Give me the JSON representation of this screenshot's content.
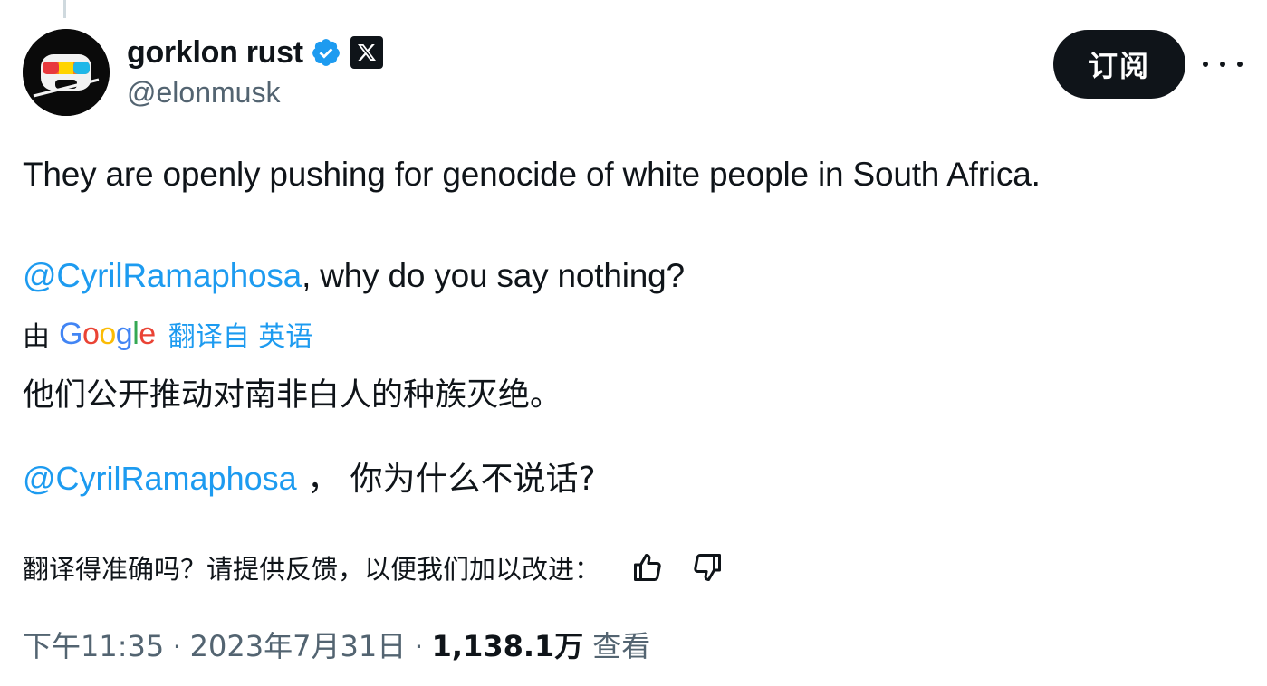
{
  "author": {
    "display_name": "gorklon rust",
    "handle": "@elonmusk",
    "verified_icon": "verified-badge-icon",
    "affiliation_icon": "x-logo-icon",
    "accent_color": "#1d9bf0"
  },
  "actions": {
    "subscribe_label": "订阅",
    "more_icon": "more-horizontal-icon"
  },
  "tweet": {
    "line1": "They are openly pushing for genocide of white people in South Africa.",
    "mention": "@CyrilRamaphosa",
    "line2_rest": ", why do you say nothing?"
  },
  "translation": {
    "by_label": "由",
    "provider_letters": [
      "G",
      "o",
      "o",
      "g",
      "l",
      "e"
    ],
    "translated_from": "翻译自 英语",
    "line1": "他们公开推动对南非白人的种族灭绝。",
    "mention": "@CyrilRamaphosa",
    "line2_rest": " ，  你为什么不说话?",
    "feedback_prompt": "翻译得准确吗？请提供反馈，以便我们加以改进：",
    "thumbs_up_icon": "thumbs-up-icon",
    "thumbs_down_icon": "thumbs-down-icon"
  },
  "meta": {
    "time": "下午11:35",
    "separator": " · ",
    "date": "2023年7月31日",
    "separator2": " · ",
    "views_count": "1,138.1万",
    "views_label": "查看"
  }
}
